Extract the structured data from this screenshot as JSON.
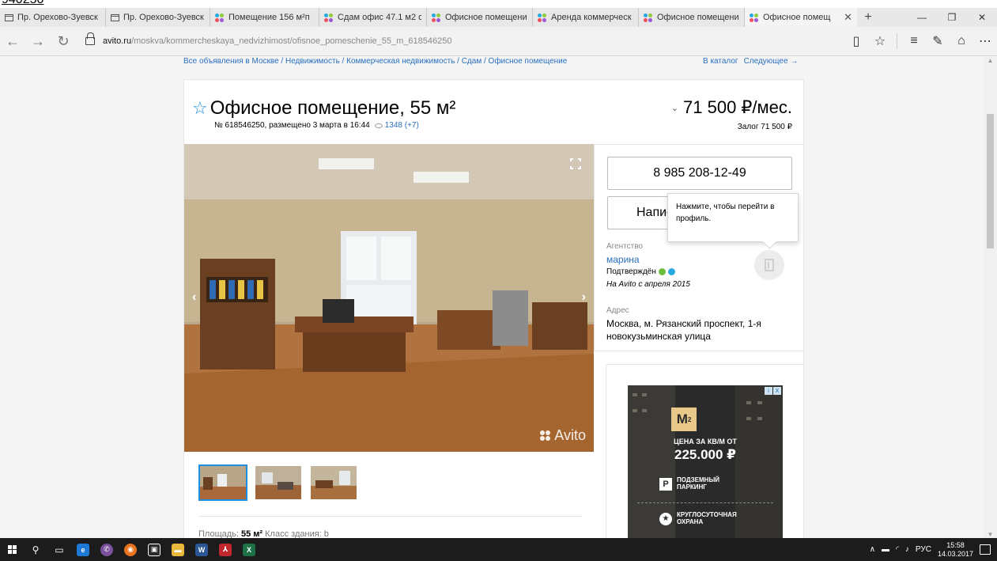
{
  "top_crop_text": "940250",
  "browser": {
    "tabs": [
      {
        "label": "Пр. Орехово-Зуевск",
        "icon": "page-icon",
        "active": false
      },
      {
        "label": "Пр. Орехово-Зуевск",
        "icon": "page-icon",
        "active": false
      },
      {
        "label": "Помещение 156 м²п",
        "icon": "avito-icon",
        "active": false
      },
      {
        "label": "Сдам офис 47.1 м2 о",
        "icon": "avito-icon",
        "active": false
      },
      {
        "label": "Офисное помещени",
        "icon": "avito-icon",
        "active": false
      },
      {
        "label": "Аренда коммерческ",
        "icon": "avito-icon",
        "active": false
      },
      {
        "label": "Офисное помещени",
        "icon": "avito-icon",
        "active": false
      },
      {
        "label": "Офисное помещ",
        "icon": "avito-icon",
        "active": true
      }
    ],
    "tab_close": "✕",
    "new_tab": "+",
    "window_controls": {
      "minimize": "—",
      "maximize": "❐",
      "close": "✕"
    },
    "url_host": "avito.ru",
    "url_path": "/moskva/kommercheskaya_nedvizhimost/ofisnoe_pomeschenie_55_m_618546250"
  },
  "page": {
    "breadcrumbs": "Все объявления в Москве / Недвижимость / Коммерческая недвижимость / Сдам / Офисное помещение",
    "catalog_link": "В каталог",
    "next_link": "Следующее →",
    "title": "Офисное помещение, 55 м²",
    "listing_meta": "№ 618546250, размещено 3 марта в 16:44",
    "views": "1348 (+7)",
    "price": "71 500 ₽/мес.",
    "deposit": "Залог 71 500 ₽",
    "watermark": "Avito",
    "area_label": "Площадь: ",
    "area_value": "55 м²",
    "building_class": " Класс здания: b",
    "contact": {
      "phone": "8 985 208-12-49",
      "write_button": "Написать сообщение",
      "tooltip": "Нажмите, чтобы перейти в профиль.",
      "agency_label": "Агентство",
      "agent_name": "марина",
      "verified_label": "Подтверждён",
      "since": "На Avito с апреля 2015",
      "address_label": "Адрес",
      "address": "Москва, м. Рязанский проспект, 1-я новокузьминская улица"
    },
    "ad": {
      "logo": "M",
      "logo_sup": "2",
      "price_label": "ЦЕНА ЗА КВ/М ОТ",
      "price_value": "225.000 ₽",
      "feature1_badge": "P",
      "feature1": "ПОДЗЕМНЫЙ ПАРКИНГ",
      "feature2": "КРУГЛОСУТОЧНАЯ ОХРАНА",
      "close_i": "i",
      "close_x": "X"
    }
  },
  "taskbar": {
    "lang": "РУС",
    "time": "15:58",
    "date": "14.03.2017"
  },
  "colors": {
    "accent": "#1e8fe0",
    "link": "#2a6fbe",
    "taskbar": "#1c1c1c"
  }
}
